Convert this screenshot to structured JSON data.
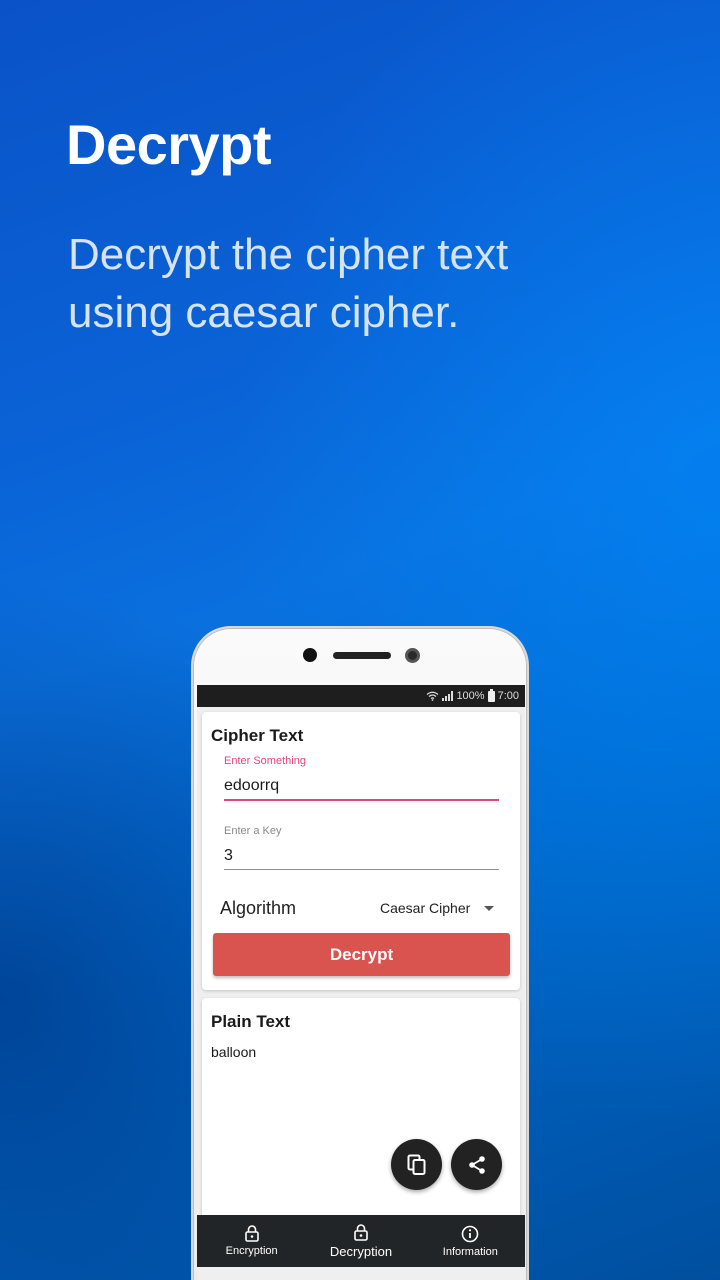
{
  "promo": {
    "headline": "Decrypt",
    "subline_1": "Decrypt the cipher text",
    "subline_2": "using caesar cipher."
  },
  "status_bar": {
    "battery": "100%",
    "time": "7:00"
  },
  "cipher_card": {
    "title": "Cipher Text",
    "input_label": "Enter Something",
    "input_value": "edoorrq",
    "key_label": "Enter a Key",
    "key_value": "3",
    "algorithm_label": "Algorithm",
    "algorithm_value": "Caesar Cipher",
    "button_label": "Decrypt"
  },
  "plain_card": {
    "title": "Plain Text",
    "value": "balloon"
  },
  "bottom_nav": {
    "items": [
      {
        "label": "Encryption",
        "icon": "lock-icon"
      },
      {
        "label": "Decryption",
        "icon": "lock-icon"
      },
      {
        "label": "Information",
        "icon": "info-icon"
      }
    ],
    "active_index": 1
  },
  "colors": {
    "accent": "#e5467a",
    "button": "#d9534f",
    "fab": "#222222",
    "nav_bg": "#222527"
  }
}
